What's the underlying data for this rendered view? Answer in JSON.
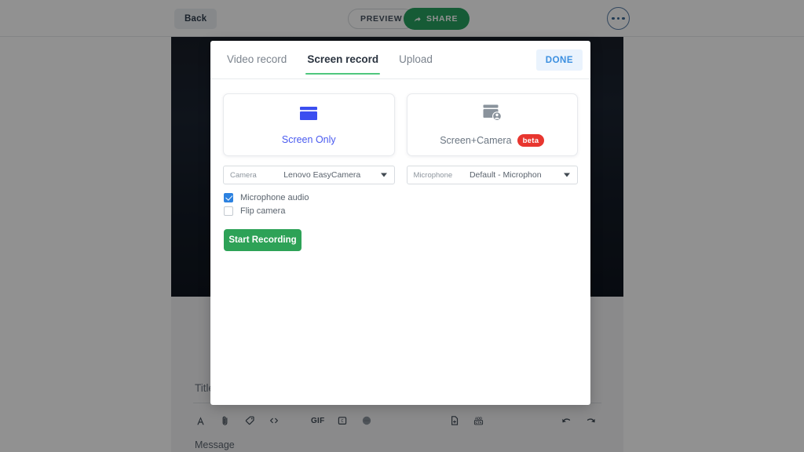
{
  "top_toolbar": {
    "back_label": "Back",
    "preview_label": "PREVIEW",
    "share_label": "SHARE",
    "share_icon": "share-arrow-icon",
    "more_icon": "more-options-icon"
  },
  "editor": {
    "title_placeholder": "Title",
    "message_placeholder": "Message",
    "toolbar_icons": [
      {
        "name": "text-format-icon",
        "glyph": "A"
      },
      {
        "name": "attachment-icon",
        "glyph": "paperclip"
      },
      {
        "name": "tag-icon",
        "glyph": "tag"
      },
      {
        "name": "code-icon",
        "glyph": "<>"
      },
      {
        "name": "gif-icon",
        "glyph": "GIF"
      },
      {
        "name": "calendar-icon",
        "glyph": "C"
      },
      {
        "name": "color-circle-icon",
        "glyph": "circle"
      },
      {
        "name": "insert-file-icon",
        "glyph": "file-plus"
      },
      {
        "name": "add-cta-icon",
        "glyph": "ADD CTA"
      },
      {
        "name": "undo-icon",
        "glyph": "undo"
      },
      {
        "name": "redo-icon",
        "glyph": "redo"
      }
    ],
    "gif_label": "GIF",
    "cta_label_top": "ADD",
    "cta_label_bottom": "CTA"
  },
  "modal": {
    "tabs": [
      {
        "label": "Video record",
        "active": false
      },
      {
        "label": "Screen record",
        "active": true
      },
      {
        "label": "Upload",
        "active": false
      }
    ],
    "done_label": "DONE",
    "mode_cards": [
      {
        "label": "Screen Only",
        "icon": "screen-window-icon",
        "selected": true,
        "badge": ""
      },
      {
        "label": "Screen+Camera",
        "icon": "screen-camera-person-icon",
        "selected": false,
        "badge": "beta"
      }
    ],
    "selects": [
      {
        "name": "camera-select",
        "label": "Camera",
        "value": "Lenovo EasyCamera"
      },
      {
        "name": "microphone-select",
        "label": "Microphone",
        "value": "Default - Microphon"
      }
    ],
    "checkboxes": [
      {
        "name": "microphone-audio-checkbox",
        "label": "Microphone audio",
        "checked": true
      },
      {
        "name": "flip-camera-checkbox",
        "label": "Flip camera",
        "checked": false
      }
    ],
    "start_recording_label": "Start Recording"
  },
  "colors": {
    "accent_green": "#2da257",
    "tab_underline": "#4fc77d",
    "selected_blue": "#4a5bf0",
    "beta_red": "#e8362f",
    "done_blue": "#3b8fe0",
    "checkbox_blue": "#2d82e0"
  }
}
